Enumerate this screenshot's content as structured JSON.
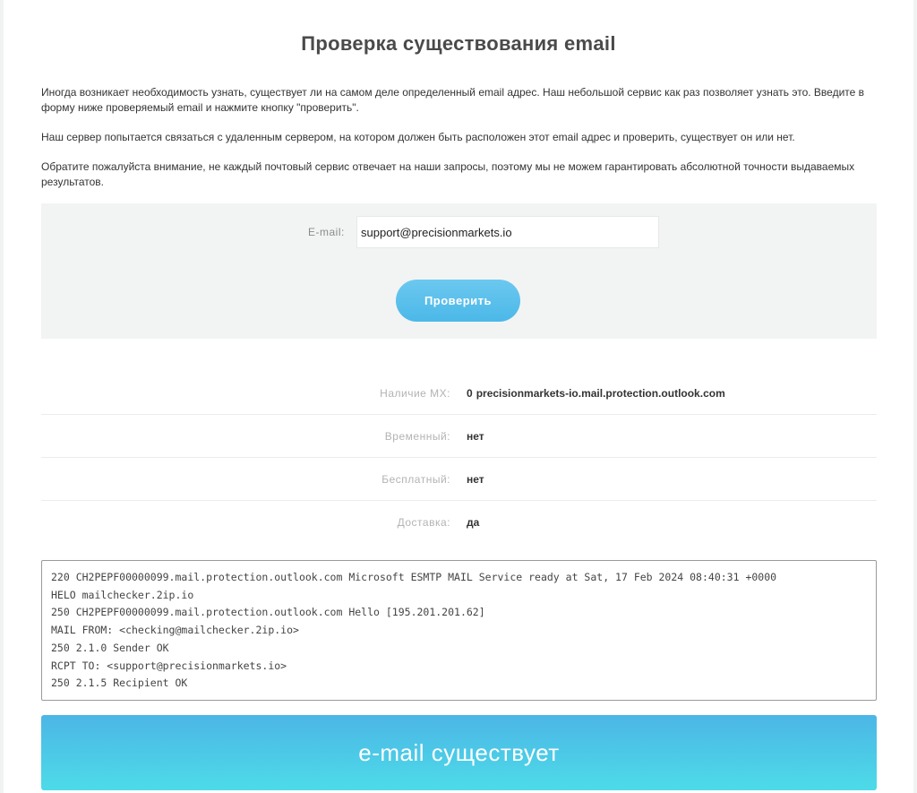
{
  "page": {
    "title": "Проверка существования email",
    "intro_p1": "Иногда возникает необходимость узнать, существует ли на самом деле определенный email адрес. Наш небольшой сервис как раз позволяет узнать это. Введите в форму ниже проверяемый email и нажмите кнопку \"проверить\".",
    "intro_p2": "Наш сервер попытается связаться с удаленным сервером, на котором должен быть расположен этот email адрес и проверить, существует он или нет.",
    "intro_p3": "Обратите пожалуйста внимание, не каждый почтовый сервис отвечает на наши запросы, поэтому мы не можем гарантировать абсолютной точности выдаваемых результатов."
  },
  "form": {
    "email_label": "E-mail:",
    "email_value": "support@precisionmarkets.io",
    "submit_label": "Проверить"
  },
  "results": [
    {
      "label": "Наличие MX:",
      "value": "precisionmarkets-io.mail.protection.outlook.com",
      "bullet": "0"
    },
    {
      "label": "Временный:",
      "value": "нет"
    },
    {
      "label": "Бесплатный:",
      "value": "нет"
    },
    {
      "label": "Доставка:",
      "value": "да"
    }
  ],
  "smtp_log": [
    "220 CH2PEPF00000099.mail.protection.outlook.com Microsoft ESMTP MAIL Service ready at Sat, 17 Feb 2024 08:40:31 +0000",
    "HELO mailchecker.2ip.io",
    "250 CH2PEPF00000099.mail.protection.outlook.com Hello [195.201.201.62]",
    "MAIL FROM: <checking@mailchecker.2ip.io>",
    "250 2.1.0 Sender OK",
    "RCPT TO: <support@precisionmarkets.io>",
    "250 2.1.5 Recipient OK"
  ],
  "banner": {
    "text": "e-mail существует",
    "color_start": "#4cb6e6",
    "color_end": "#4ddbe8"
  },
  "colors": {
    "button": "#5bbfec",
    "panel": "#f2f4f4"
  }
}
